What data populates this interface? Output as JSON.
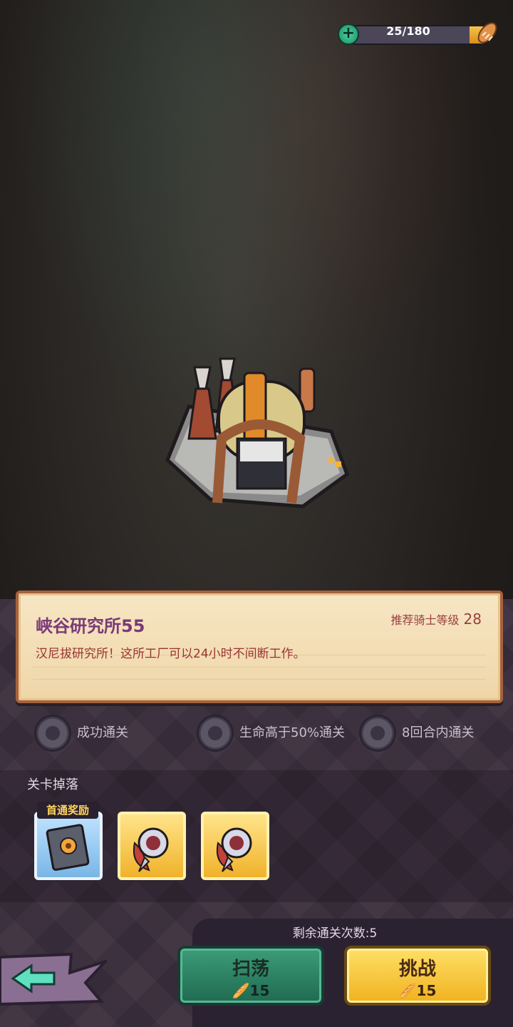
{
  "energy": {
    "value": "25/180",
    "current": 25,
    "max": 180
  },
  "stage": {
    "title": "峡谷研究所55",
    "recommend_label": "推荐骑士等级",
    "recommend_level": "28",
    "description": "汉尼拔研究所！这所工厂可以24小时不间断工作。"
  },
  "conditions": [
    "成功通关",
    "生命高于50%通关",
    "8回合内通关"
  ],
  "drops": {
    "label": "关卡掉落",
    "first_clear_tag": "首通奖励",
    "items": [
      {
        "name": "book-icon",
        "rarity": "blue"
      },
      {
        "name": "compass-badge-icon",
        "rarity": "gold"
      },
      {
        "name": "compass-badge-icon",
        "rarity": "gold"
      }
    ]
  },
  "remaining": "剩余通关次数:5",
  "buttons": {
    "sweep": {
      "label": "扫荡",
      "cost": "15"
    },
    "challenge": {
      "label": "挑战",
      "cost": "15"
    }
  },
  "colors": {
    "gold": "#f0b11f",
    "green": "#2f8a68",
    "purple_bg": "#3a2d3c",
    "title": "#7a3a78"
  }
}
